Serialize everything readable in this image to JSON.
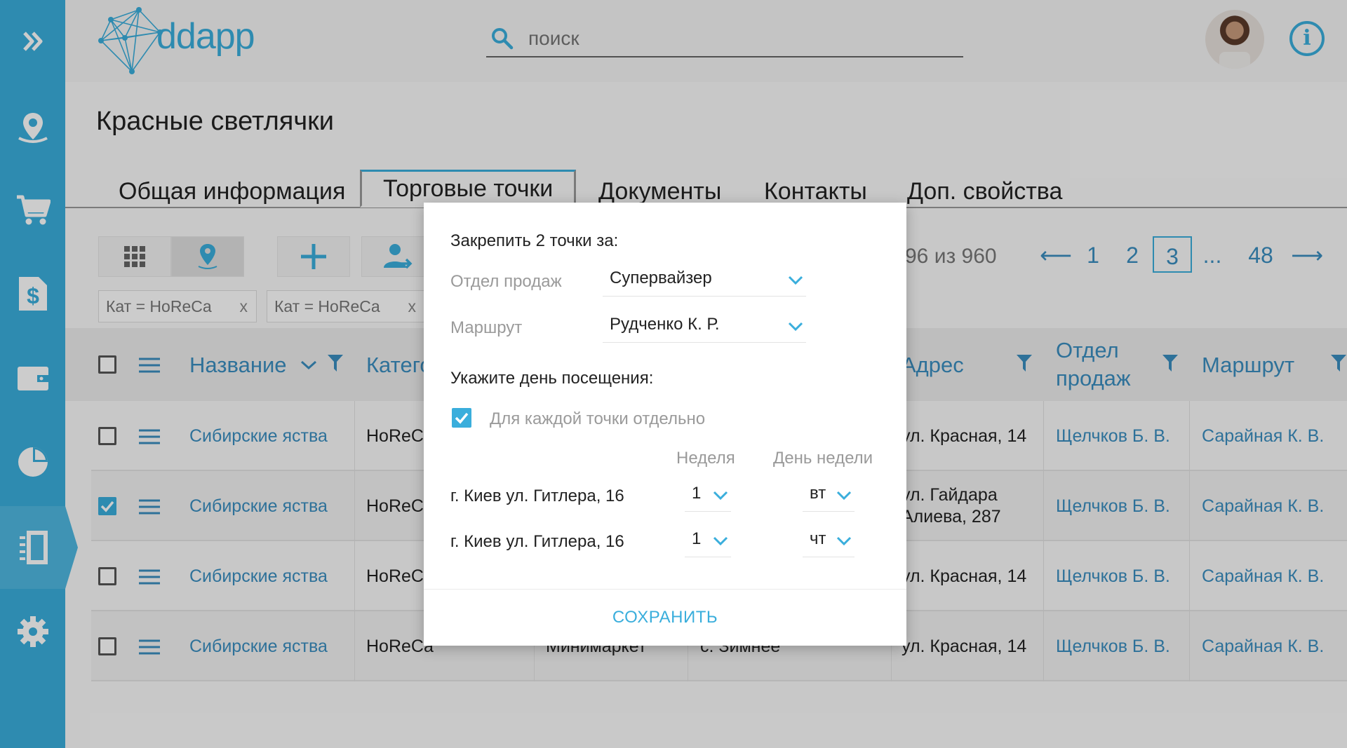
{
  "header": {
    "logo_text": "ddapp",
    "search_placeholder": "поиск"
  },
  "page": {
    "title": "Красные светлячки",
    "tabs": [
      {
        "label": "Общая информация"
      },
      {
        "label": "Торговые точки"
      },
      {
        "label": "Документы"
      },
      {
        "label": "Контакты"
      },
      {
        "label": "Доп. свойства"
      }
    ],
    "active_tab": "Торговые точки"
  },
  "toolbar": {
    "filters": [
      "Кат = HoReCa",
      "Кат = HoReCa"
    ],
    "filter_close": "x",
    "range_text": "96 из 960",
    "pages": [
      "1",
      "2",
      "3",
      "...",
      "48"
    ],
    "current_page": "3",
    "prev_arrow": "⟵",
    "next_arrow": "⟶"
  },
  "table": {
    "columns": {
      "name": "Название",
      "category": "Категория",
      "address": "Адрес",
      "sales_dept": "Отдел продаж",
      "route": "Маршрут"
    },
    "rows": [
      {
        "name": "Сибирские яства",
        "category": "HoReCa",
        "type": "",
        "city": "",
        "address": "ул. Красная, 14",
        "dept": "Щелчков Б. В.",
        "route": "Сарайная К. В.",
        "checked": false
      },
      {
        "name": "Сибирские яства",
        "category": "HoReCa",
        "type": "",
        "city": "",
        "address": "ул. Гайдара Алиева, 287",
        "dept": "Щелчков Б. В.",
        "route": "Сарайная К. В.",
        "checked": true
      },
      {
        "name": "Сибирские яства",
        "category": "HoReCa",
        "type": "",
        "city": "",
        "address": "ул. Красная, 14",
        "dept": "Щелчков Б. В.",
        "route": "Сарайная К. В.",
        "checked": false
      },
      {
        "name": "Сибирские яства",
        "category": "HoReCa",
        "type": "Минимаркет",
        "city": "с. Зимнее",
        "address": "ул. Красная, 14",
        "dept": "Щелчков Б. В.",
        "route": "Сарайная К. В.",
        "checked": false
      }
    ]
  },
  "modal": {
    "heading": "Закрепить 2 точки за:",
    "dept_label": "Отдел продаж",
    "dept_value": "Супервайзер",
    "route_label": "Маршрут",
    "route_value": "Рудченко К. Р.",
    "visit_label": "Укажите день посещения:",
    "each_point_label": "Для каждой точки отдельно",
    "each_point_checked": true,
    "week_header": "Неделя",
    "weekday_header": "День недели",
    "points": [
      {
        "address": "г. Киев ул. Гитлера, 16",
        "week": "1",
        "weekday": "вт"
      },
      {
        "address": "г. Киев ул. Гитлера, 16",
        "week": "1",
        "weekday": "чт"
      }
    ],
    "save_label": "СОХРАНИТЬ"
  },
  "colors": {
    "accent": "#3aaedc",
    "link": "#3a8ec0",
    "sidebar": "#3aaedc"
  }
}
